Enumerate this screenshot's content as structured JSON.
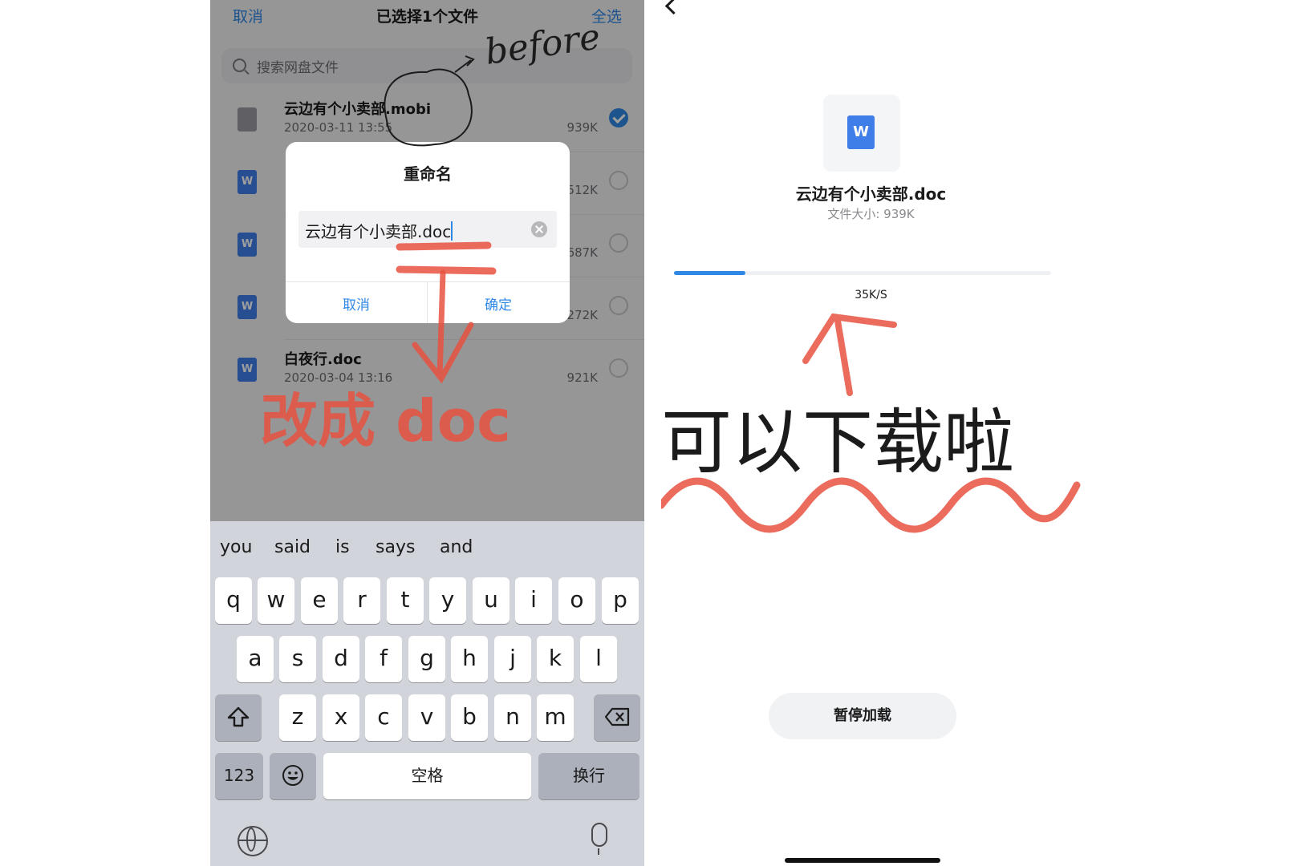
{
  "left": {
    "nav": {
      "cancel": "取消",
      "title": "已选择1个文件",
      "select_all": "全选"
    },
    "search_placeholder": "搜索网盘文件",
    "files": [
      {
        "name": "云边有个小卖部.mobi",
        "date": "2020-03-11 13:55",
        "size": "939K",
        "type": "other",
        "selected": true
      },
      {
        "name": "",
        "date": "",
        "size": "512K",
        "type": "word",
        "selected": false
      },
      {
        "name": "",
        "date": "",
        "size": "687K",
        "type": "word",
        "selected": false
      },
      {
        "name": "",
        "date": "",
        "size": "272K",
        "type": "word",
        "selected": false
      },
      {
        "name": "白夜行.doc",
        "date": "2020-03-04 13:16",
        "size": "921K",
        "type": "word",
        "selected": false
      }
    ],
    "dialog": {
      "title": "重命名",
      "input_value": "云边有个小卖部.doc",
      "cancel": "取消",
      "confirm": "确定"
    },
    "keyboard": {
      "suggestions": [
        "you",
        "said",
        "is",
        "says",
        "and"
      ],
      "row1": [
        "q",
        "w",
        "e",
        "r",
        "t",
        "y",
        "u",
        "i",
        "o",
        "p"
      ],
      "row2": [
        "a",
        "s",
        "d",
        "f",
        "g",
        "h",
        "j",
        "k",
        "l"
      ],
      "row3": [
        "z",
        "x",
        "c",
        "v",
        "b",
        "n",
        "m"
      ],
      "numbers": "123",
      "space": "空格",
      "return": "换行"
    },
    "annotations": {
      "before": "before",
      "change_to": "改成 doc"
    }
  },
  "right": {
    "file_name": "云边有个小卖部.doc",
    "file_size": "文件大小: 939K",
    "progress": 0.19,
    "speed": "35K/S",
    "pause_button": "暂停加载",
    "annotation": "可以下载啦"
  },
  "colors": {
    "accent": "#2f88e6",
    "word_icon": "#3f7ee8",
    "annotation": "#e8513f"
  }
}
